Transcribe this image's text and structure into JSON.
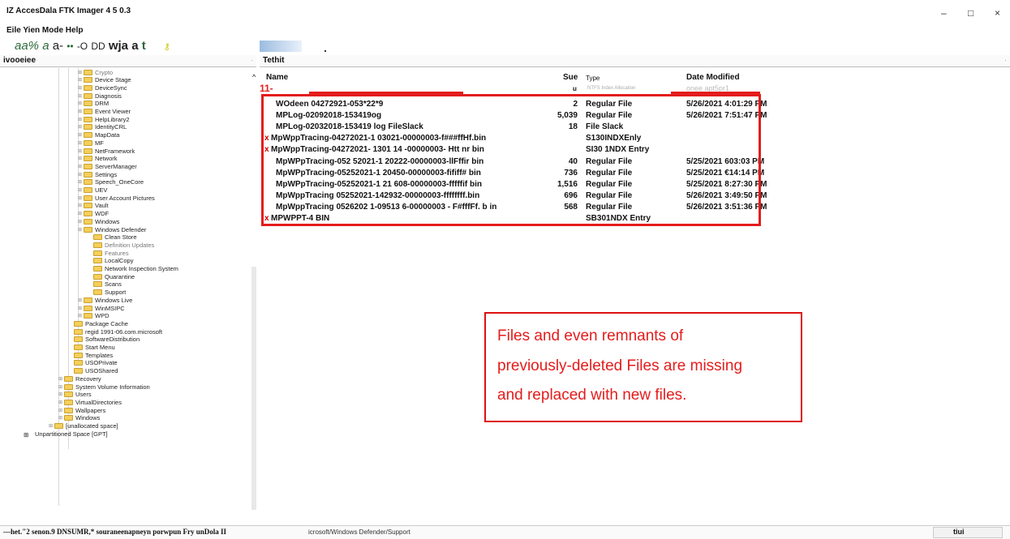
{
  "window": {
    "title": "IZ AccesDala FTK Imager 4 5 0.3",
    "min_icon": "–",
    "max_icon": "□",
    "close_icon": "×"
  },
  "menubar": {
    "text": "Eile Yien Mode Help"
  },
  "toolbar": {
    "seg1": "aa%",
    "seg2": "a",
    "seg3": "a-",
    "seg4": "••",
    "seg5": "-O",
    "seg6": "DD",
    "seg7": "wja",
    "seg8": "a",
    "seg9": "t",
    "key_icon": "key-icon"
  },
  "left_pane": {
    "header": "ivooeiee"
  },
  "right_pane": {
    "header": "Tethit"
  },
  "columns": {
    "name": "Name",
    "size": "Sue",
    "type": "Type",
    "date": "Date Modified"
  },
  "red_marker": "11-",
  "partial_row": {
    "size": "u",
    "type": "NTFS Index Allocation",
    "date": "onee apt5pr1"
  },
  "files": [
    {
      "del": "",
      "name": "WOdeen 04272921-053*22*9",
      "size": "2",
      "type": "Regular File",
      "date": "5/26/2021 4:01:29 PM"
    },
    {
      "del": "",
      "name": "MPLog-02092018-153419og",
      "size": "5,039",
      "type": "Regular File",
      "date": "5/26/2021 7:51:47 PM"
    },
    {
      "del": "",
      "name": "MPLog-02032018-153419 log FileSlack",
      "size": "18",
      "type": "File Slack",
      "date": ""
    },
    {
      "del": "x",
      "name": "MpWppTracing-04272021-1 03021-00000003-f###ffHf.bin",
      "size": "",
      "type": "S130INDXEnly",
      "date": ""
    },
    {
      "del": "x",
      "name": "MpWppTracing-04272021- 1301 14 -00000003- Htt nr bin",
      "size": "",
      "type": "SI30 1NDX Entry",
      "date": ""
    },
    {
      "del": "",
      "name": "MpWPpTracing-052 52021-1 20222-00000003-llFffir bin",
      "size": "40",
      "type": "Regular File",
      "date": "5/25/2021 603:03 PM"
    },
    {
      "del": "",
      "name": "MpWPpTracing-05252021-1 20450-00000003-fififf# bin",
      "size": "736",
      "type": "Regular File",
      "date": "5/25/2021 €14:14 PM"
    },
    {
      "del": "",
      "name": "MpWPpTracing-05252021-1 21 608-00000003-fffffif bin",
      "size": "1,516",
      "type": "Regular File",
      "date": "5/25/2021 8:27:30 PM"
    },
    {
      "del": "",
      "name": "MpWppTracing 05252021-142932-00000003-ffffffff.bin",
      "size": "696",
      "type": "Regular File",
      "date": "5/26/2021 3:49:50 PM"
    },
    {
      "del": "",
      "name": "MpWppTracing 0526202 1-09513 6-00000003 - F#fffFf. b in",
      "size": "568",
      "type": "Regular File",
      "date": "5/26/2021 3:51:36 PM"
    },
    {
      "del": "x",
      "name": "MPWPPT-4 BIN",
      "size": "",
      "type": "SB301NDX Entry",
      "date": ""
    }
  ],
  "tree": [
    {
      "label": "Crypto",
      "indent": 3,
      "gray": true
    },
    {
      "label": "Device Stage",
      "indent": 3
    },
    {
      "label": "DeviceSync",
      "indent": 3
    },
    {
      "label": "Diagnosis",
      "indent": 3
    },
    {
      "label": "DRM",
      "indent": 3
    },
    {
      "label": "Event Viewer",
      "indent": 3
    },
    {
      "label": "HelpLibrary2",
      "indent": 3
    },
    {
      "label": "IdentityCRL",
      "indent": 3
    },
    {
      "label": "MapData",
      "indent": 3
    },
    {
      "label": "MF",
      "indent": 3
    },
    {
      "label": "NetFramework",
      "indent": 3
    },
    {
      "label": "Network",
      "indent": 3
    },
    {
      "label": "ServerManager",
      "indent": 3
    },
    {
      "label": "Settings",
      "indent": 3
    },
    {
      "label": "Speech_OneCore",
      "indent": 3
    },
    {
      "label": "UEV",
      "indent": 3
    },
    {
      "label": "User Account Pictures",
      "indent": 3
    },
    {
      "label": "Vault",
      "indent": 3
    },
    {
      "label": "WDF",
      "indent": 3
    },
    {
      "label": "Windows",
      "indent": 3
    },
    {
      "label": "Windows Defender",
      "indent": 3
    },
    {
      "label": "Clean Store",
      "indent": 4
    },
    {
      "label": "Definition Updates",
      "indent": 4,
      "gray": true
    },
    {
      "label": "Features",
      "indent": 4,
      "gray": true
    },
    {
      "label": "LocalCopy",
      "indent": 4
    },
    {
      "label": "Network Inspection System",
      "indent": 4
    },
    {
      "label": "Quarantine",
      "indent": 4
    },
    {
      "label": "Scans",
      "indent": 4
    },
    {
      "label": "Support",
      "indent": 4
    },
    {
      "label": "Windows Live",
      "indent": 3
    },
    {
      "label": "WinMSIPC",
      "indent": 3
    },
    {
      "label": "WPD",
      "indent": 3
    },
    {
      "label": "Package Cache",
      "indent": 2
    },
    {
      "label": "regid 1991-06.com.microsoft",
      "indent": 2
    },
    {
      "label": "SoftwareDistribution",
      "indent": 2
    },
    {
      "label": "Start Menu",
      "indent": 2
    },
    {
      "label": "Templates",
      "indent": 2
    },
    {
      "label": "USOPrivate",
      "indent": 2
    },
    {
      "label": "USOShared",
      "indent": 2
    },
    {
      "label": "Recovery",
      "indent": 1
    },
    {
      "label": "System Volume Information",
      "indent": 1
    },
    {
      "label": "Users",
      "indent": 1
    },
    {
      "label": "VirtualDirectories",
      "indent": 1
    },
    {
      "label": "Wallpapers",
      "indent": 1
    },
    {
      "label": "Windows",
      "indent": 1
    },
    {
      "label": "[unallocated space]",
      "indent": 0
    },
    {
      "label": "Unpartitioned Space [GPT]",
      "indent": -1
    }
  ],
  "annotation": {
    "line1": "Files and even remnants of",
    "line2": "previously-deleted Files are missing",
    "line3": "and replaced with new files."
  },
  "statusbar": {
    "left": "—het.\"2 senon.9 DNSUMR,* souraneenapneyn porwpun Fry unDola II",
    "path": "icrosoft/Windows Defender/Support",
    "right": "tiui"
  }
}
